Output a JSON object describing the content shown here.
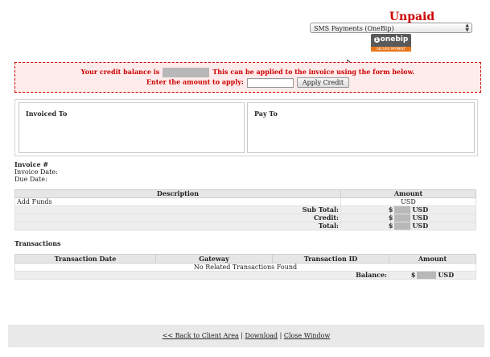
{
  "invoice": {
    "status": "Unpaid",
    "gateway_selected": "SMS Payments (OneBip)",
    "gateway_logo": {
      "brand": "onebip",
      "tagline": "SECURE PAYMENT"
    }
  },
  "credit": {
    "line1_pre": "Your credit balance is",
    "line1_post": "This can be applied to the invoice using the form below.",
    "line2_label": "Enter the amount to apply:",
    "apply_button": "Apply Credit"
  },
  "addresses": {
    "invoiced_to": "Invoiced To",
    "pay_to": "Pay To"
  },
  "meta": {
    "invoice_number_label": "Invoice #",
    "invoice_date_label": "Invoice Date:",
    "due_date_label": "Due Date:"
  },
  "items_table": {
    "headers": [
      "Description",
      "Amount"
    ],
    "rows": [
      {
        "description": "Add Funds",
        "amount": "USD"
      }
    ],
    "summary": [
      {
        "label": "Sub Total:",
        "currency_prefix": "$",
        "currency": "USD"
      },
      {
        "label": "Credit:",
        "currency_prefix": "$",
        "currency": "USD"
      },
      {
        "label": "Total:",
        "currency_prefix": "$",
        "currency": "USD"
      }
    ]
  },
  "transactions": {
    "title": "Transactions",
    "headers": [
      "Transaction Date",
      "Gateway",
      "Transaction ID",
      "Amount"
    ],
    "empty_message": "No Related Transactions Found",
    "balance_label": "Balance:",
    "balance_prefix": "$",
    "balance_currency": "USD"
  },
  "footer": {
    "back_link": "<< Back to Client Area",
    "separator": "|",
    "download_link": "Download",
    "close_link": "Close Window"
  }
}
